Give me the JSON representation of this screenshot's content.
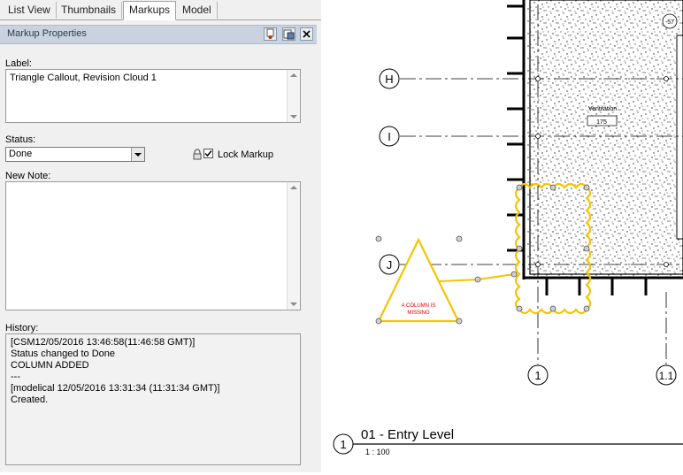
{
  "tabs": [
    {
      "label": "List View",
      "active": false
    },
    {
      "label": "Thumbnails",
      "active": false
    },
    {
      "label": "Markups",
      "active": true
    },
    {
      "label": "Model",
      "active": false
    }
  ],
  "panel": {
    "title": "Markup Properties",
    "label_caption": "Label:",
    "label_value": "Triangle Callout, Revision Cloud 1",
    "status_caption": "Status:",
    "status_value": "Done",
    "lock_label": "Lock Markup",
    "lock_checked": true,
    "new_note_caption": "New Note:",
    "history_caption": "History:",
    "history_lines": [
      "[CSM12/05/2016 13:46:58(11:46:58 GMT)]",
      "Status changed to Done",
      "COLUMN ADDED",
      "---",
      "[modelical  12/05/2016  13:31:34  (11:31:34 GMT)]",
      "Created."
    ]
  },
  "drawing": {
    "grid_h": "H",
    "grid_i": "I",
    "grid_j": "J",
    "grid_1": "1",
    "grid_1_1": "1.1",
    "view_number": "1",
    "view_title": "01 - Entry Level",
    "view_scale": "1 : 100",
    "callout_text_line1": "A COLUMN IS",
    "callout_text_line2": "MISSING",
    "room_tag_line1": "Ventilation",
    "room_tag_line2": "175",
    "top_tag": "-57",
    "markup_color": "#f5c400",
    "callout_text_color": "#e00000"
  }
}
